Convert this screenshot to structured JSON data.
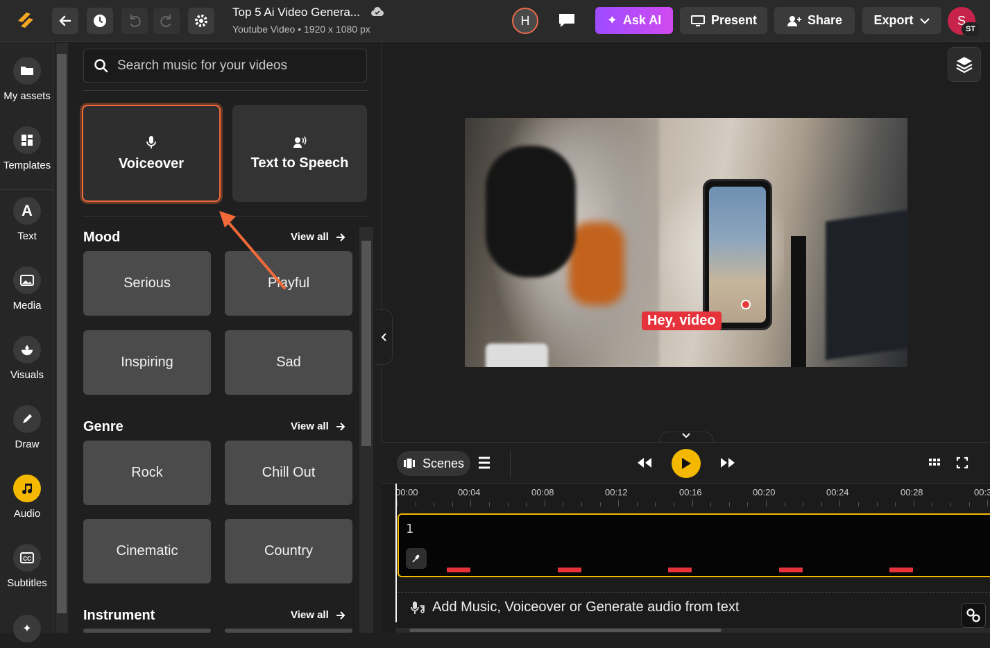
{
  "topbar": {
    "title": "Top 5 Ai Video Genera...",
    "subtitle": "Youtube Video • 1920 x 1080 px",
    "collab_initial": "H",
    "ask_ai_label": "Ask AI",
    "present_label": "Present",
    "share_label": "Share",
    "export_label": "Export",
    "user_initial": "S",
    "user_badge": "ST",
    "askai_gradient": [
      "#9d4bff",
      "#d04bf0"
    ]
  },
  "sidebar": {
    "items": [
      {
        "label": "My assets",
        "icon": "folder-icon"
      },
      {
        "label": "Templates",
        "icon": "templates-icon"
      },
      {
        "label": "Text",
        "icon": "text-icon"
      },
      {
        "label": "Media",
        "icon": "image-icon"
      },
      {
        "label": "Visuals",
        "icon": "visuals-icon"
      },
      {
        "label": "Draw",
        "icon": "pen-icon"
      },
      {
        "label": "Audio",
        "icon": "music-note-icon",
        "active": true
      },
      {
        "label": "Subtitles",
        "icon": "cc-icon"
      }
    ]
  },
  "panel": {
    "search_placeholder": "Search music for your videos",
    "voiceover_label": "Voiceover",
    "tts_label": "Text to Speech",
    "view_all_label": "View all",
    "sections": [
      {
        "title": "Mood",
        "tiles": [
          "Serious",
          "Playful",
          "Inspiring",
          "Sad"
        ]
      },
      {
        "title": "Genre",
        "tiles": [
          "Rock",
          "Chill Out",
          "Cinematic",
          "Country"
        ]
      },
      {
        "title": "Instrument",
        "tiles": []
      }
    ]
  },
  "canvas": {
    "caption_text": "Hey, video"
  },
  "timeline": {
    "scenes_label": "Scenes",
    "ticks": [
      "00:00",
      "00:04",
      "00:08",
      "00:12",
      "00:16",
      "00:20",
      "00:24",
      "00:28",
      "00:3"
    ],
    "scene_number": "1",
    "audio_prompt": "Add Music, Voiceover or Generate audio from text"
  },
  "colors": {
    "accent": "#f5b800",
    "highlight": "#f26a3a",
    "caption": "#e5323b"
  }
}
